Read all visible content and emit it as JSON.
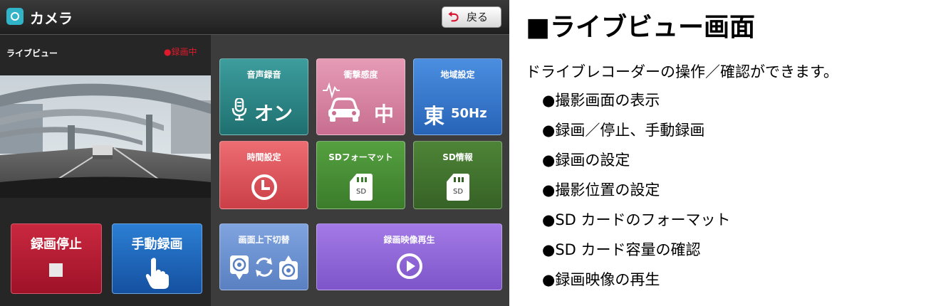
{
  "app": {
    "title": "カメラ",
    "back_label": "戻る",
    "liveview_label": "ライブビュー",
    "rec_status": "●録画中"
  },
  "left_buttons": {
    "stop_label": "録画停止",
    "manual_label": "手動録画"
  },
  "tiles": {
    "voice": {
      "label": "音声録音",
      "value": "オン"
    },
    "shock": {
      "label": "衝撃感度",
      "value": "中"
    },
    "region": {
      "label": "地域設定",
      "value_big": "東",
      "value_small": "50Hz"
    },
    "time": {
      "label": "時間設定"
    },
    "sdformat": {
      "label": "SDフォーマット",
      "icon_text": "SD"
    },
    "sdinfo": {
      "label": "SD情報",
      "icon_text": "SD"
    },
    "flip": {
      "label": "画面上下切替"
    },
    "playback": {
      "label": "録画映像再生"
    }
  },
  "doc": {
    "title": "■ライブビュー画面",
    "description": "ドライブレコーダーの操作／確認ができます。",
    "items": [
      "●撮影画面の表示",
      "●録画／停止、手動録画",
      "●録画の設定",
      "●撮影位置の設定",
      "●SD カードのフォーマット",
      "●SD カード容量の確認",
      "●録画映像の再生"
    ]
  },
  "colors": {
    "rec_red": "#e01a2a",
    "stop_button": "#b51c34",
    "manual_button": "#1f66bd",
    "voice_tile": "#2e8686",
    "shock_tile": "#d884a3",
    "region_tile": "#3879cc",
    "time_tile": "#dc565d",
    "sdformat_tile": "#4a8e36",
    "sdinfo_tile": "#42732e",
    "flip_tile": "#6c92d0",
    "playback_tile": "#9068d8"
  }
}
